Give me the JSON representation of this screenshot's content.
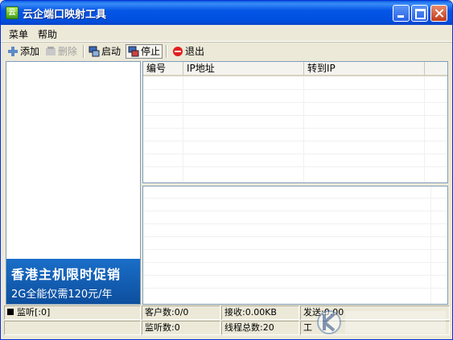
{
  "window": {
    "title": "云企端口映射工具"
  },
  "menu": {
    "items": [
      "菜单",
      "帮助"
    ]
  },
  "toolbar": {
    "add": "添加",
    "delete": "删除",
    "start": "启动",
    "stop": "停止",
    "exit": "退出"
  },
  "mapping_table": {
    "columns": [
      "编号",
      "IP地址",
      "转到IP"
    ],
    "rows": []
  },
  "banner": {
    "line1": "香港主机限时促销",
    "line2": "2G全能仅需120元/年"
  },
  "statusbar": {
    "listen": "监听[:0]",
    "clients": "客户数:0/0",
    "received": "接收:0.00KB",
    "sent": "发送:0.00",
    "listen_count": "监听数:0",
    "threads": "线程总数:20",
    "work": "工"
  },
  "colors": {
    "titlebar": "#0556e6",
    "banner": "#1a6ec8",
    "close": "#c43a1c"
  }
}
